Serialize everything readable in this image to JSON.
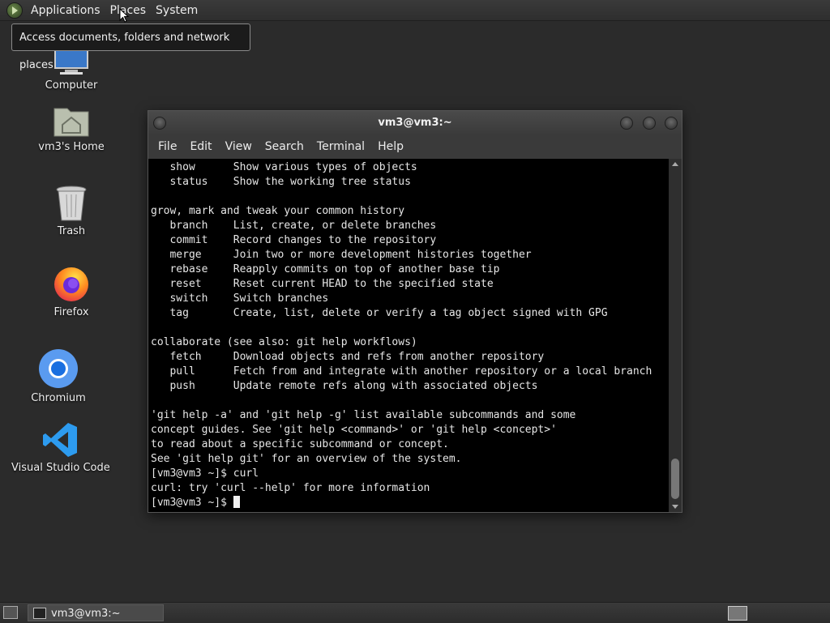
{
  "top_panel": {
    "menus": [
      "Applications",
      "Places",
      "System"
    ],
    "tooltip": "Access documents, folders and network places"
  },
  "desktop": {
    "icons": [
      {
        "label": "Computer",
        "icon": "computer-icon"
      },
      {
        "label": "vm3's Home",
        "icon": "home-folder-icon"
      },
      {
        "label": "Trash",
        "icon": "trash-icon"
      },
      {
        "label": "Firefox",
        "icon": "firefox-icon"
      },
      {
        "label": "Chromium",
        "icon": "chromium-icon"
      },
      {
        "label": "Visual Studio Code",
        "icon": "vscode-icon"
      }
    ]
  },
  "terminal": {
    "title": "vm3@vm3:~",
    "menus": [
      "File",
      "Edit",
      "View",
      "Search",
      "Terminal",
      "Help"
    ],
    "lines": [
      "   show      Show various types of objects",
      "   status    Show the working tree status",
      "",
      "grow, mark and tweak your common history",
      "   branch    List, create, or delete branches",
      "   commit    Record changes to the repository",
      "   merge     Join two or more development histories together",
      "   rebase    Reapply commits on top of another base tip",
      "   reset     Reset current HEAD to the specified state",
      "   switch    Switch branches",
      "   tag       Create, list, delete or verify a tag object signed with GPG",
      "",
      "collaborate (see also: git help workflows)",
      "   fetch     Download objects and refs from another repository",
      "   pull      Fetch from and integrate with another repository or a local branch",
      "   push      Update remote refs along with associated objects",
      "",
      "'git help -a' and 'git help -g' list available subcommands and some",
      "concept guides. See 'git help <command>' or 'git help <concept>'",
      "to read about a specific subcommand or concept.",
      "See 'git help git' for an overview of the system.",
      "[vm3@vm3 ~]$ curl",
      "curl: try 'curl --help' for more information"
    ],
    "prompt": "[vm3@vm3 ~]$ "
  },
  "bottom_panel": {
    "task_label": "vm3@vm3:~"
  }
}
